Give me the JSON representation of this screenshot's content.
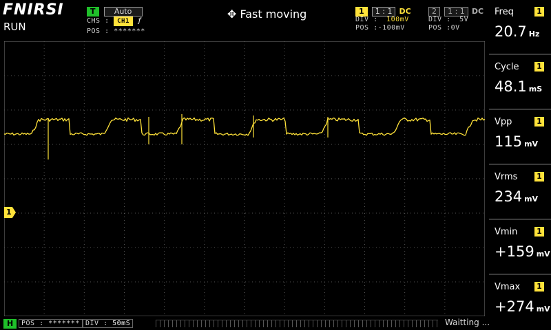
{
  "header": {
    "brand": "FNIRSI",
    "run_state": "RUN",
    "trigger": {
      "badge": "T",
      "mode": "Auto",
      "source_label": "CHS :",
      "source": "CH1",
      "edge_symbol": "ƒ",
      "pos_label": "POS :",
      "pos_value": "*******"
    },
    "mode_text": "Fast moving",
    "ch1": {
      "num": "1",
      "probe": "1 : 1",
      "coupling": "DC",
      "div_label": "DIV :",
      "div_value": "100mV",
      "pos_label": "POS :",
      "pos_value": "-100mV"
    },
    "ch2": {
      "num": "2",
      "probe": "1 : 1",
      "coupling": "DC",
      "div_label": "DIV :",
      "div_value": "5V",
      "pos_label": "POS :",
      "pos_value": "0V"
    }
  },
  "measurements": [
    {
      "name": "Freq",
      "channel": "1",
      "value": "20.7",
      "unit": "Hz"
    },
    {
      "name": "Cycle",
      "channel": "1",
      "value": "48.1",
      "unit": "mS"
    },
    {
      "name": "Vpp",
      "channel": "1",
      "value": "115",
      "unit": "mV"
    },
    {
      "name": "Vrms",
      "channel": "1",
      "value": "234",
      "unit": "mV"
    },
    {
      "name": "Vmin",
      "channel": "1",
      "value": "+159",
      "unit": "mV"
    },
    {
      "name": "Vmax",
      "channel": "1",
      "value": "+274",
      "unit": "mV"
    }
  ],
  "footer": {
    "h_badge": "H",
    "pos_label": "POS :",
    "pos_value": "*******",
    "div_label": "DIV :",
    "div_value": "50mS",
    "status": "Waitting ..."
  },
  "channel_marker": "1",
  "colors": {
    "trace": "#ffe23a",
    "grid": "#555555",
    "trigger_badge": "#1fbf2a"
  },
  "icons": {
    "move": "move-arrows-icon"
  }
}
